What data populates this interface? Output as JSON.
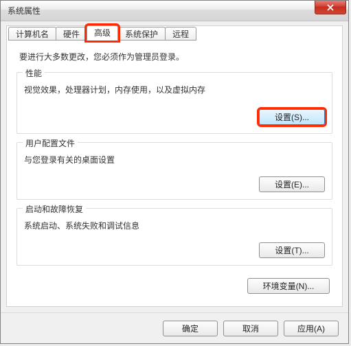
{
  "title": "系统属性",
  "tabs": {
    "computerName": "计算机名",
    "hardware": "硬件",
    "advanced": "高级",
    "systemProtection": "系统保护",
    "remote": "远程"
  },
  "activeTab": "advanced",
  "infoText": "要进行大多数更改，您必须作为管理员登录。",
  "groups": {
    "performance": {
      "label": "性能",
      "desc": "视觉效果，处理器计划，内存使用，以及虚拟内存",
      "button": "设置(S)..."
    },
    "userProfiles": {
      "label": "用户配置文件",
      "desc": "与您登录有关的桌面设置",
      "button": "设置(E)..."
    },
    "startupRecovery": {
      "label": "启动和故障恢复",
      "desc": "系统启动、系统失败和调试信息",
      "button": "设置(T)..."
    }
  },
  "envVarsButton": "环境变量(N)...",
  "footer": {
    "ok": "确定",
    "cancel": "取消",
    "apply": "应用(A)"
  }
}
